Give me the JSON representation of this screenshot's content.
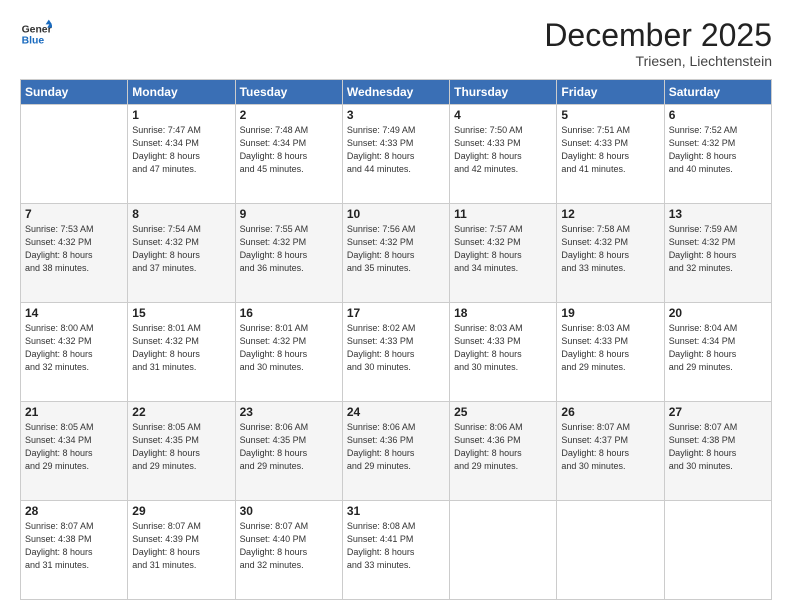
{
  "header": {
    "logo_line1": "General",
    "logo_line2": "Blue",
    "month": "December 2025",
    "location": "Triesen, Liechtenstein"
  },
  "days_of_week": [
    "Sunday",
    "Monday",
    "Tuesday",
    "Wednesday",
    "Thursday",
    "Friday",
    "Saturday"
  ],
  "weeks": [
    [
      {
        "day": "",
        "info": ""
      },
      {
        "day": "1",
        "info": "Sunrise: 7:47 AM\nSunset: 4:34 PM\nDaylight: 8 hours\nand 47 minutes."
      },
      {
        "day": "2",
        "info": "Sunrise: 7:48 AM\nSunset: 4:34 PM\nDaylight: 8 hours\nand 45 minutes."
      },
      {
        "day": "3",
        "info": "Sunrise: 7:49 AM\nSunset: 4:33 PM\nDaylight: 8 hours\nand 44 minutes."
      },
      {
        "day": "4",
        "info": "Sunrise: 7:50 AM\nSunset: 4:33 PM\nDaylight: 8 hours\nand 42 minutes."
      },
      {
        "day": "5",
        "info": "Sunrise: 7:51 AM\nSunset: 4:33 PM\nDaylight: 8 hours\nand 41 minutes."
      },
      {
        "day": "6",
        "info": "Sunrise: 7:52 AM\nSunset: 4:32 PM\nDaylight: 8 hours\nand 40 minutes."
      }
    ],
    [
      {
        "day": "7",
        "info": "Sunrise: 7:53 AM\nSunset: 4:32 PM\nDaylight: 8 hours\nand 38 minutes."
      },
      {
        "day": "8",
        "info": "Sunrise: 7:54 AM\nSunset: 4:32 PM\nDaylight: 8 hours\nand 37 minutes."
      },
      {
        "day": "9",
        "info": "Sunrise: 7:55 AM\nSunset: 4:32 PM\nDaylight: 8 hours\nand 36 minutes."
      },
      {
        "day": "10",
        "info": "Sunrise: 7:56 AM\nSunset: 4:32 PM\nDaylight: 8 hours\nand 35 minutes."
      },
      {
        "day": "11",
        "info": "Sunrise: 7:57 AM\nSunset: 4:32 PM\nDaylight: 8 hours\nand 34 minutes."
      },
      {
        "day": "12",
        "info": "Sunrise: 7:58 AM\nSunset: 4:32 PM\nDaylight: 8 hours\nand 33 minutes."
      },
      {
        "day": "13",
        "info": "Sunrise: 7:59 AM\nSunset: 4:32 PM\nDaylight: 8 hours\nand 32 minutes."
      }
    ],
    [
      {
        "day": "14",
        "info": "Sunrise: 8:00 AM\nSunset: 4:32 PM\nDaylight: 8 hours\nand 32 minutes."
      },
      {
        "day": "15",
        "info": "Sunrise: 8:01 AM\nSunset: 4:32 PM\nDaylight: 8 hours\nand 31 minutes."
      },
      {
        "day": "16",
        "info": "Sunrise: 8:01 AM\nSunset: 4:32 PM\nDaylight: 8 hours\nand 30 minutes."
      },
      {
        "day": "17",
        "info": "Sunrise: 8:02 AM\nSunset: 4:33 PM\nDaylight: 8 hours\nand 30 minutes."
      },
      {
        "day": "18",
        "info": "Sunrise: 8:03 AM\nSunset: 4:33 PM\nDaylight: 8 hours\nand 30 minutes."
      },
      {
        "day": "19",
        "info": "Sunrise: 8:03 AM\nSunset: 4:33 PM\nDaylight: 8 hours\nand 29 minutes."
      },
      {
        "day": "20",
        "info": "Sunrise: 8:04 AM\nSunset: 4:34 PM\nDaylight: 8 hours\nand 29 minutes."
      }
    ],
    [
      {
        "day": "21",
        "info": "Sunrise: 8:05 AM\nSunset: 4:34 PM\nDaylight: 8 hours\nand 29 minutes."
      },
      {
        "day": "22",
        "info": "Sunrise: 8:05 AM\nSunset: 4:35 PM\nDaylight: 8 hours\nand 29 minutes."
      },
      {
        "day": "23",
        "info": "Sunrise: 8:06 AM\nSunset: 4:35 PM\nDaylight: 8 hours\nand 29 minutes."
      },
      {
        "day": "24",
        "info": "Sunrise: 8:06 AM\nSunset: 4:36 PM\nDaylight: 8 hours\nand 29 minutes."
      },
      {
        "day": "25",
        "info": "Sunrise: 8:06 AM\nSunset: 4:36 PM\nDaylight: 8 hours\nand 29 minutes."
      },
      {
        "day": "26",
        "info": "Sunrise: 8:07 AM\nSunset: 4:37 PM\nDaylight: 8 hours\nand 30 minutes."
      },
      {
        "day": "27",
        "info": "Sunrise: 8:07 AM\nSunset: 4:38 PM\nDaylight: 8 hours\nand 30 minutes."
      }
    ],
    [
      {
        "day": "28",
        "info": "Sunrise: 8:07 AM\nSunset: 4:38 PM\nDaylight: 8 hours\nand 31 minutes."
      },
      {
        "day": "29",
        "info": "Sunrise: 8:07 AM\nSunset: 4:39 PM\nDaylight: 8 hours\nand 31 minutes."
      },
      {
        "day": "30",
        "info": "Sunrise: 8:07 AM\nSunset: 4:40 PM\nDaylight: 8 hours\nand 32 minutes."
      },
      {
        "day": "31",
        "info": "Sunrise: 8:08 AM\nSunset: 4:41 PM\nDaylight: 8 hours\nand 33 minutes."
      },
      {
        "day": "",
        "info": ""
      },
      {
        "day": "",
        "info": ""
      },
      {
        "day": "",
        "info": ""
      }
    ]
  ]
}
